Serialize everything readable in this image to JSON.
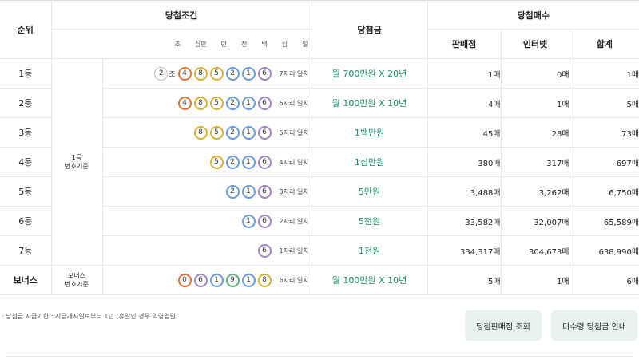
{
  "header": {
    "rank": "순위",
    "condition": "당첨조건",
    "prize": "당첨금",
    "count": "당첨매수",
    "digit_labels": [
      "조",
      "십만",
      "만",
      "천",
      "백",
      "십",
      "일"
    ],
    "store": "판매점",
    "internet": "인터넷",
    "total": "합계"
  },
  "basis": {
    "main": [
      "1등",
      "번호기준"
    ],
    "bonus": [
      "보너스",
      "번호기준"
    ]
  },
  "ball_colors": {
    "0": "#e0763a",
    "1": "#6b9be0",
    "2": "#6b9be0",
    "4": "#e0763a",
    "5": "#d8b232",
    "6": "#a284c9",
    "8": "#d8b232",
    "9": "#5cb377",
    "plain": "#bdbdbd"
  },
  "rows": [
    {
      "rank": "1등",
      "jo_ball": "2",
      "jo_label": "조",
      "balls": [
        "4",
        "8",
        "5",
        "2",
        "1",
        "6"
      ],
      "match": "7자리 일치",
      "prize": "월 700만원 X 20년",
      "store": "1매",
      "internet": "0매",
      "total": "1매"
    },
    {
      "rank": "2등",
      "balls": [
        "4",
        "8",
        "5",
        "2",
        "1",
        "6"
      ],
      "match": "6자리 일치",
      "prize": "월 100만원 X 10년",
      "store": "4매",
      "internet": "1매",
      "total": "5매"
    },
    {
      "rank": "3등",
      "balls": [
        "8",
        "5",
        "2",
        "1",
        "6"
      ],
      "match": "5자리 일치",
      "prize": "1백만원",
      "store": "45매",
      "internet": "28매",
      "total": "73매"
    },
    {
      "rank": "4등",
      "balls": [
        "5",
        "2",
        "1",
        "6"
      ],
      "match": "4자리 일치",
      "prize": "1십만원",
      "store": "380매",
      "internet": "317매",
      "total": "697매"
    },
    {
      "rank": "5등",
      "balls": [
        "2",
        "1",
        "6"
      ],
      "match": "3자리 일치",
      "prize": "5만원",
      "store": "3,488매",
      "internet": "3,262매",
      "total": "6,750매"
    },
    {
      "rank": "6등",
      "balls": [
        "1",
        "6"
      ],
      "match": "2자리 일치",
      "prize": "5천원",
      "store": "33,582매",
      "internet": "32,007매",
      "total": "65,589매"
    },
    {
      "rank": "7등",
      "balls": [
        "6"
      ],
      "match": "1자리 일치",
      "prize": "1천원",
      "store": "334,317매",
      "internet": "304,673매",
      "total": "638,990매"
    },
    {
      "rank": "보너스",
      "balls": [
        "0",
        "6",
        "1",
        "9",
        "1",
        "8"
      ],
      "match": "6자리 일치",
      "prize": "월 100만원 X 10년",
      "store": "5매",
      "internet": "1매",
      "total": "6매"
    }
  ],
  "note": "· 당첨금 지급기한 : 지급개시일로부터 1년 (휴일인 경우 익영업일)",
  "buttons": {
    "stores": "당첨판매점 조회",
    "unclaimed": "미수령 당첨금 안내"
  }
}
